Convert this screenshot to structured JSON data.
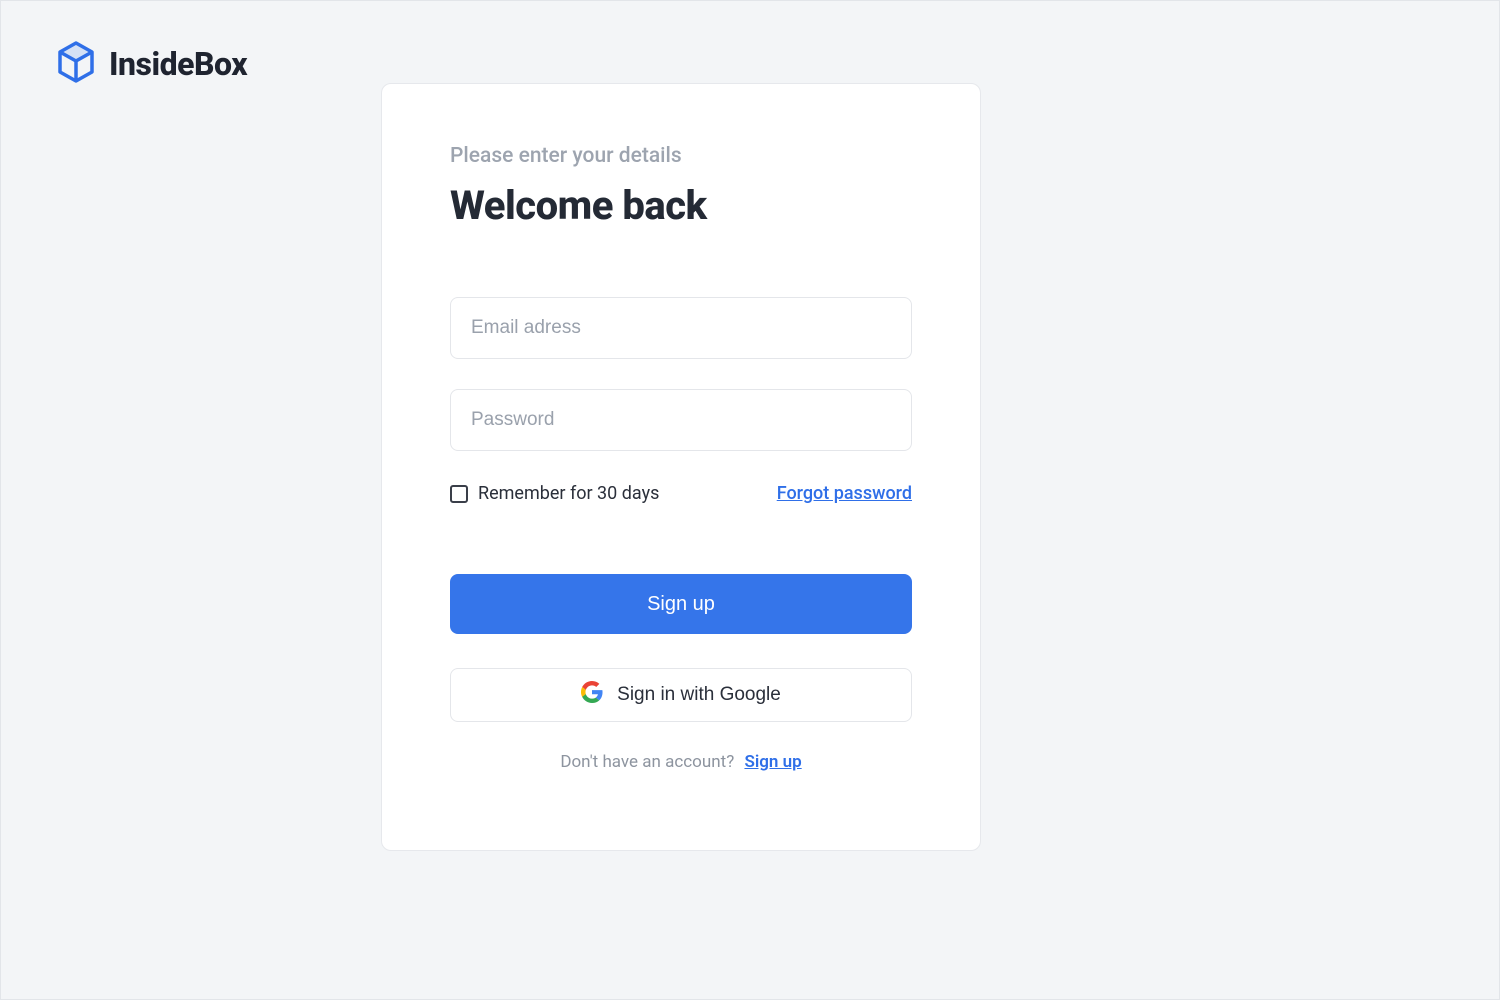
{
  "brand": {
    "name": "InsideBox"
  },
  "login": {
    "subtitle": "Please enter your details",
    "title": "Welcome back",
    "email_placeholder": "Email adress",
    "password_placeholder": "Password",
    "remember_label": "Remember for 30 days",
    "forgot_label": "Forgot password",
    "signup_button": "Sign up",
    "google_button": "Sign in with Google",
    "footer_prompt": "Don't have an account?",
    "footer_link": "Sign up"
  },
  "colors": {
    "accent": "#3575ea",
    "link": "#2f6fe8"
  }
}
